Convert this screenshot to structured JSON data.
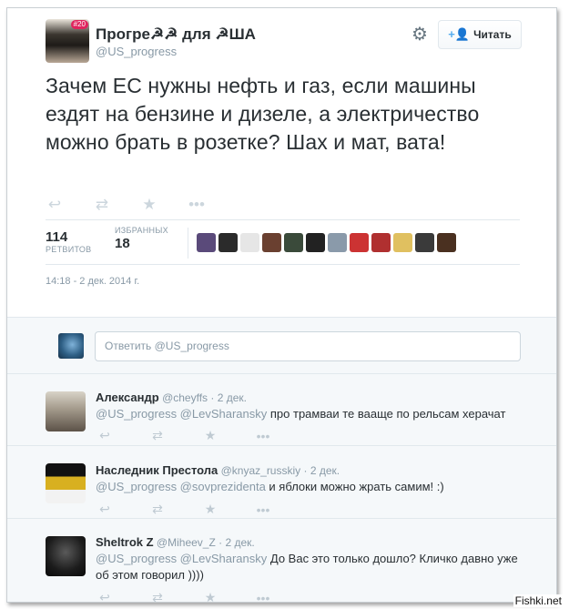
{
  "tweet": {
    "author_name": "Прогре☭☭ для ☭ША",
    "author_handle": "@US_progress",
    "avatar_badge": "#20",
    "follow_label": "Читать",
    "follow_icon": "+👤",
    "settings_icon": "gear-icon",
    "text": "Зачем ЕС нужны нефть и газ, если машины ездят на бензине и дизеле, а электричество можно брать в розетке? Шах и мат, вата!",
    "actions": {
      "reply": "↩",
      "retweet": "⇄",
      "favorite": "★",
      "more": "•••"
    },
    "retweets_count": "114",
    "retweets_label": "РЕТВИТОВ",
    "favorites_label": "ИЗБРАННЫХ",
    "favorites_count": "18",
    "favoriter_avatar_colors": [
      "#5a4a7a",
      "#2b2b2b",
      "#e6e6e6",
      "#6a4030",
      "#3a4a3a",
      "#222",
      "#8a9aaa",
      "#c33",
      "#b03030",
      "#e0c060",
      "#3a3a3a",
      "#4a3020"
    ],
    "timestamp": "14:18 - 2 дек. 2014 г."
  },
  "reply_box": {
    "placeholder": "Ответить @US_progress"
  },
  "replies": [
    {
      "name": "Александр",
      "handle": "@cheyffs",
      "time": "· 2 дек.",
      "mentions": "@US_progress @LevSharansky",
      "text": " про трамваи те вааще по рельсам херачат"
    },
    {
      "name": "Наследник Престола",
      "handle": "@knyaz_russkiy",
      "time": "· 2 дек.",
      "mentions": "@US_progress @sovprezidenta",
      "text": " и яблоки можно жрать самим! :)"
    },
    {
      "name": "Sheltrok Z",
      "handle": "@Miheev_Z",
      "time": "· 2 дек.",
      "mentions": "@US_progress @LevSharansky",
      "text": " До Вас это только дошло? Кличко давно уже об этом говорил ))))"
    }
  ],
  "watermark": "Fishki.net"
}
